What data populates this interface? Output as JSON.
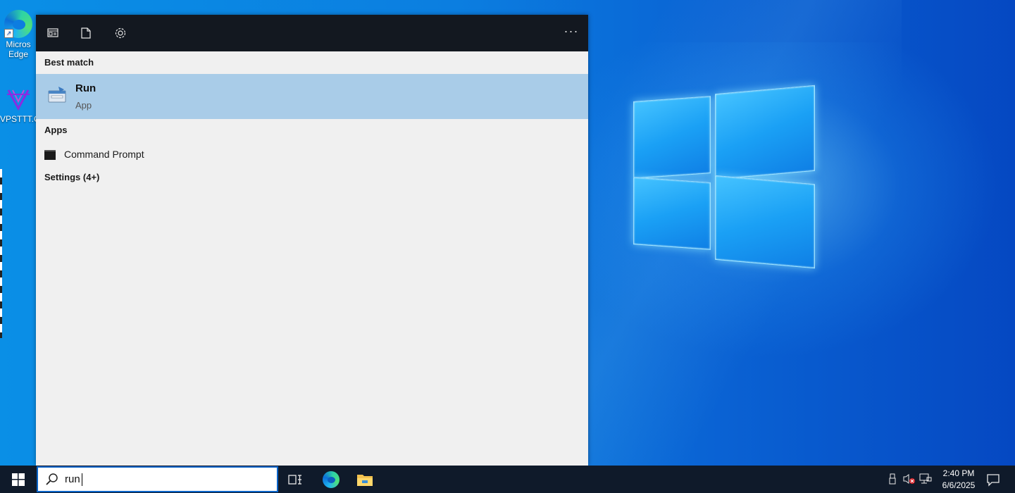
{
  "desktop": {
    "icons": [
      {
        "name": "edge",
        "label": "Micros Edge",
        "line1": "Micros",
        "line2": "Edge"
      },
      {
        "name": "vpsttt",
        "label": "VPSTTT.C"
      }
    ]
  },
  "search_panel": {
    "toolbar": {
      "all_icon": "window-layout-icon",
      "documents_icon": "document-icon",
      "settings_icon": "gear-icon",
      "more_label": "···"
    },
    "best_match": {
      "heading": "Best match",
      "title": "Run",
      "subtitle": "App",
      "icon": "run-icon"
    },
    "apps": {
      "heading": "Apps",
      "items": [
        {
          "label": "Command Prompt",
          "icon": "cmd-icon"
        }
      ]
    },
    "settings": {
      "heading": "Settings (4+)"
    }
  },
  "taskbar": {
    "search": {
      "value": "run",
      "icon": "search-icon"
    },
    "pinned": [
      "task-view-icon",
      "edge-icon",
      "file-explorer-icon"
    ],
    "tray": [
      "usb-icon",
      "volume-muted-icon",
      "network-icon"
    ],
    "clock": {
      "time": "2:40 PM",
      "date": "6/6/2025"
    }
  },
  "colors": {
    "accent": "#0a64c8",
    "panel_header": "#131820",
    "selected_row": "#a9cce8",
    "taskbar": "#0f1a2a"
  }
}
